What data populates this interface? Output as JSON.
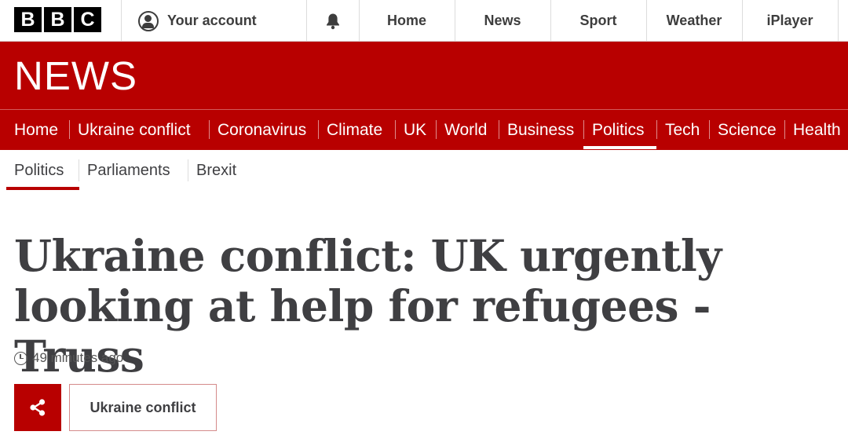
{
  "brand": {
    "letters": [
      "B",
      "B",
      "C"
    ],
    "section": "NEWS",
    "accent": "#b80000"
  },
  "topbar": {
    "account_label": "Your account",
    "nav": [
      "Home",
      "News",
      "Sport",
      "Weather",
      "iPlayer"
    ]
  },
  "main_nav": {
    "items": [
      "Home",
      "Ukraine conflict",
      "Coronavirus",
      "Climate",
      "UK",
      "World",
      "Business",
      "Politics",
      "Tech",
      "Science",
      "Health"
    ],
    "active": "Politics"
  },
  "sub_nav": {
    "items": [
      "Politics",
      "Parliaments",
      "Brexit"
    ],
    "active": "Politics"
  },
  "article": {
    "headline_line1": "Ukraine conflict: UK urgently",
    "headline_line2": "looking at help for refugees - Truss",
    "timestamp": "49 minutes ago",
    "tag": "Ukraine conflict"
  },
  "icons": [
    "account-icon",
    "bell-icon",
    "clock-icon",
    "share-icon"
  ]
}
